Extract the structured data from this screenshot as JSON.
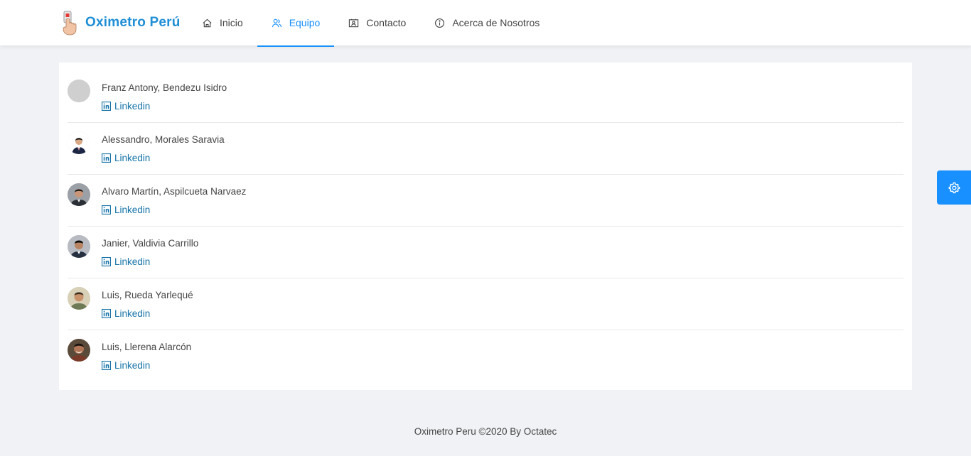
{
  "brand": {
    "name": "Oximetro Perú",
    "logo_icon": "finger-oximeter-icon"
  },
  "colors": {
    "primary": "#1890ff",
    "brand": "#1f8fd6",
    "link": "#1573a8",
    "background": "#f0f2f5"
  },
  "nav": {
    "items": [
      {
        "label": "Inicio",
        "icon": "home-icon",
        "active": false
      },
      {
        "label": "Equipo",
        "icon": "team-icon",
        "active": true
      },
      {
        "label": "Contacto",
        "icon": "contact-card-icon",
        "active": false
      },
      {
        "label": "Acerca de Nosotros",
        "icon": "info-circle-icon",
        "active": false
      }
    ]
  },
  "team": {
    "link_label": "Linkedin",
    "members": [
      {
        "name": "Franz Antony, Bendezu Isidro",
        "avatar": "placeholder"
      },
      {
        "name": "Alessandro, Morales Saravia",
        "avatar": "photo"
      },
      {
        "name": "Alvaro Martín, Aspilcueta Narvaez",
        "avatar": "photo"
      },
      {
        "name": "Janier, Valdivia Carrillo",
        "avatar": "photo"
      },
      {
        "name": "Luis, Rueda Yarlequé",
        "avatar": "photo"
      },
      {
        "name": "Luis, Llerena Alarcón",
        "avatar": "photo"
      }
    ]
  },
  "footer": {
    "text": "Oximetro Peru ©2020 By Octatec"
  },
  "settings": {
    "icon": "gear-icon"
  }
}
